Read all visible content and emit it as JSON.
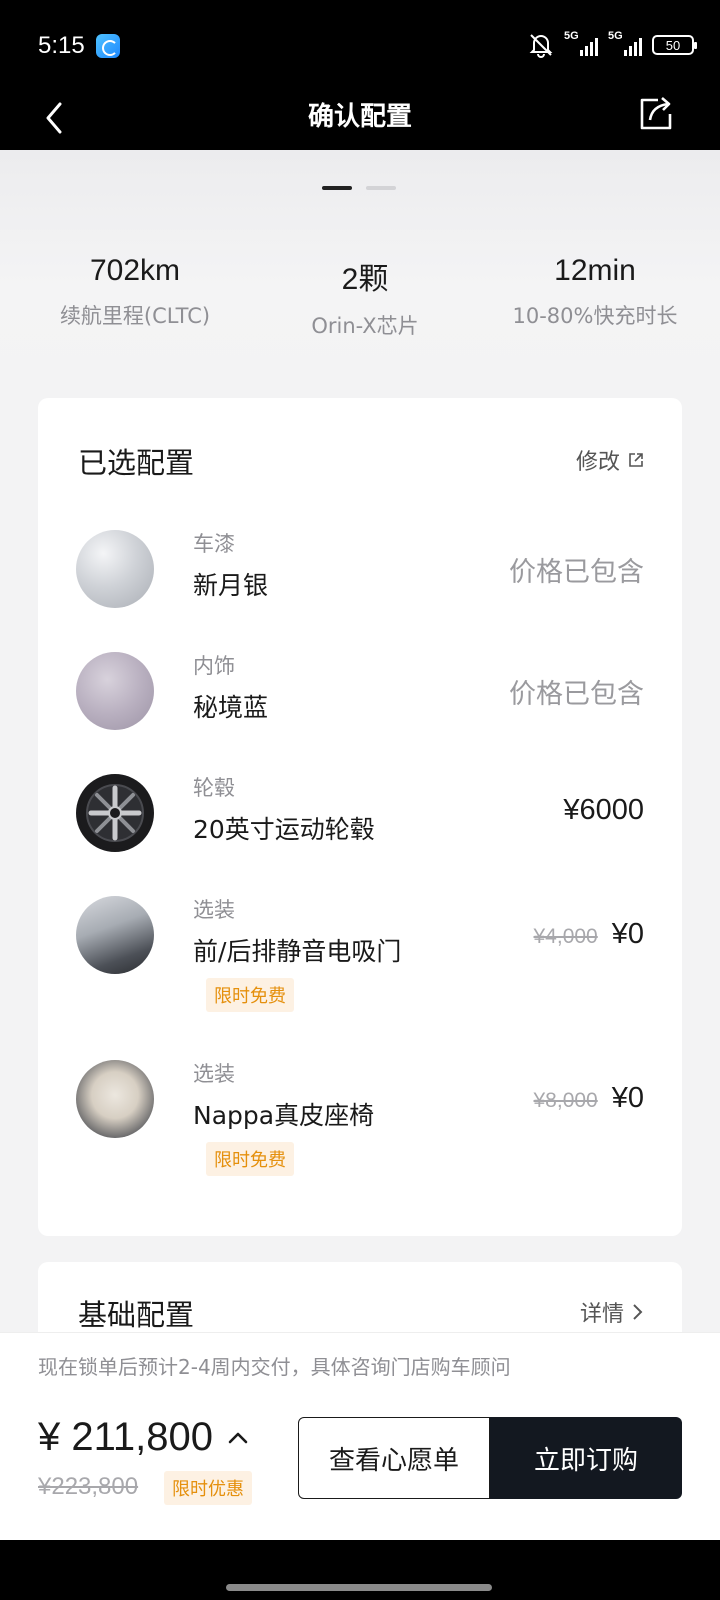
{
  "status_bar": {
    "time": "5:15",
    "signal1_label": "5G",
    "signal2_label": "5G",
    "battery": "50"
  },
  "nav": {
    "title": "确认配置"
  },
  "hero": {
    "carousel_pages": 2,
    "stats": [
      {
        "value": "702km",
        "label": "续航里程(CLTC)"
      },
      {
        "value": "2颗",
        "label": "Orin-X芯片"
      },
      {
        "value": "12min",
        "label": "10-80%快充时长"
      }
    ]
  },
  "selected": {
    "title": "已选配置",
    "edit_label": "修改",
    "items": [
      {
        "category": "车漆",
        "name": "新月银",
        "price": "价格已包含"
      },
      {
        "category": "内饰",
        "name": "秘境蓝",
        "price": "价格已包含"
      },
      {
        "category": "轮毂",
        "name": "20英寸运动轮毂",
        "price": "¥6000"
      },
      {
        "category": "选装",
        "name": "前/后排静音电吸门",
        "old_price": "¥4,000",
        "price": "¥0",
        "tag": "限时免费"
      },
      {
        "category": "选装",
        "name": "Nappa真皮座椅",
        "old_price": "¥8,000",
        "price": "¥0",
        "tag": "限时免费"
      }
    ]
  },
  "base": {
    "title": "基础配置",
    "detail_label": "详情"
  },
  "footer": {
    "notice": "现在锁单后预计2-4周内交付，具体咨询门店购车顾问",
    "total": "¥ 211,800",
    "old_total": "¥223,800",
    "promo_tag": "限时优惠",
    "wishlist_label": "查看心愿单",
    "buy_label": "立即订购"
  },
  "colors": {
    "accent_tag_bg": "#fdf1e3",
    "accent_tag_text": "#e5900d",
    "primary_button": "#131820"
  }
}
